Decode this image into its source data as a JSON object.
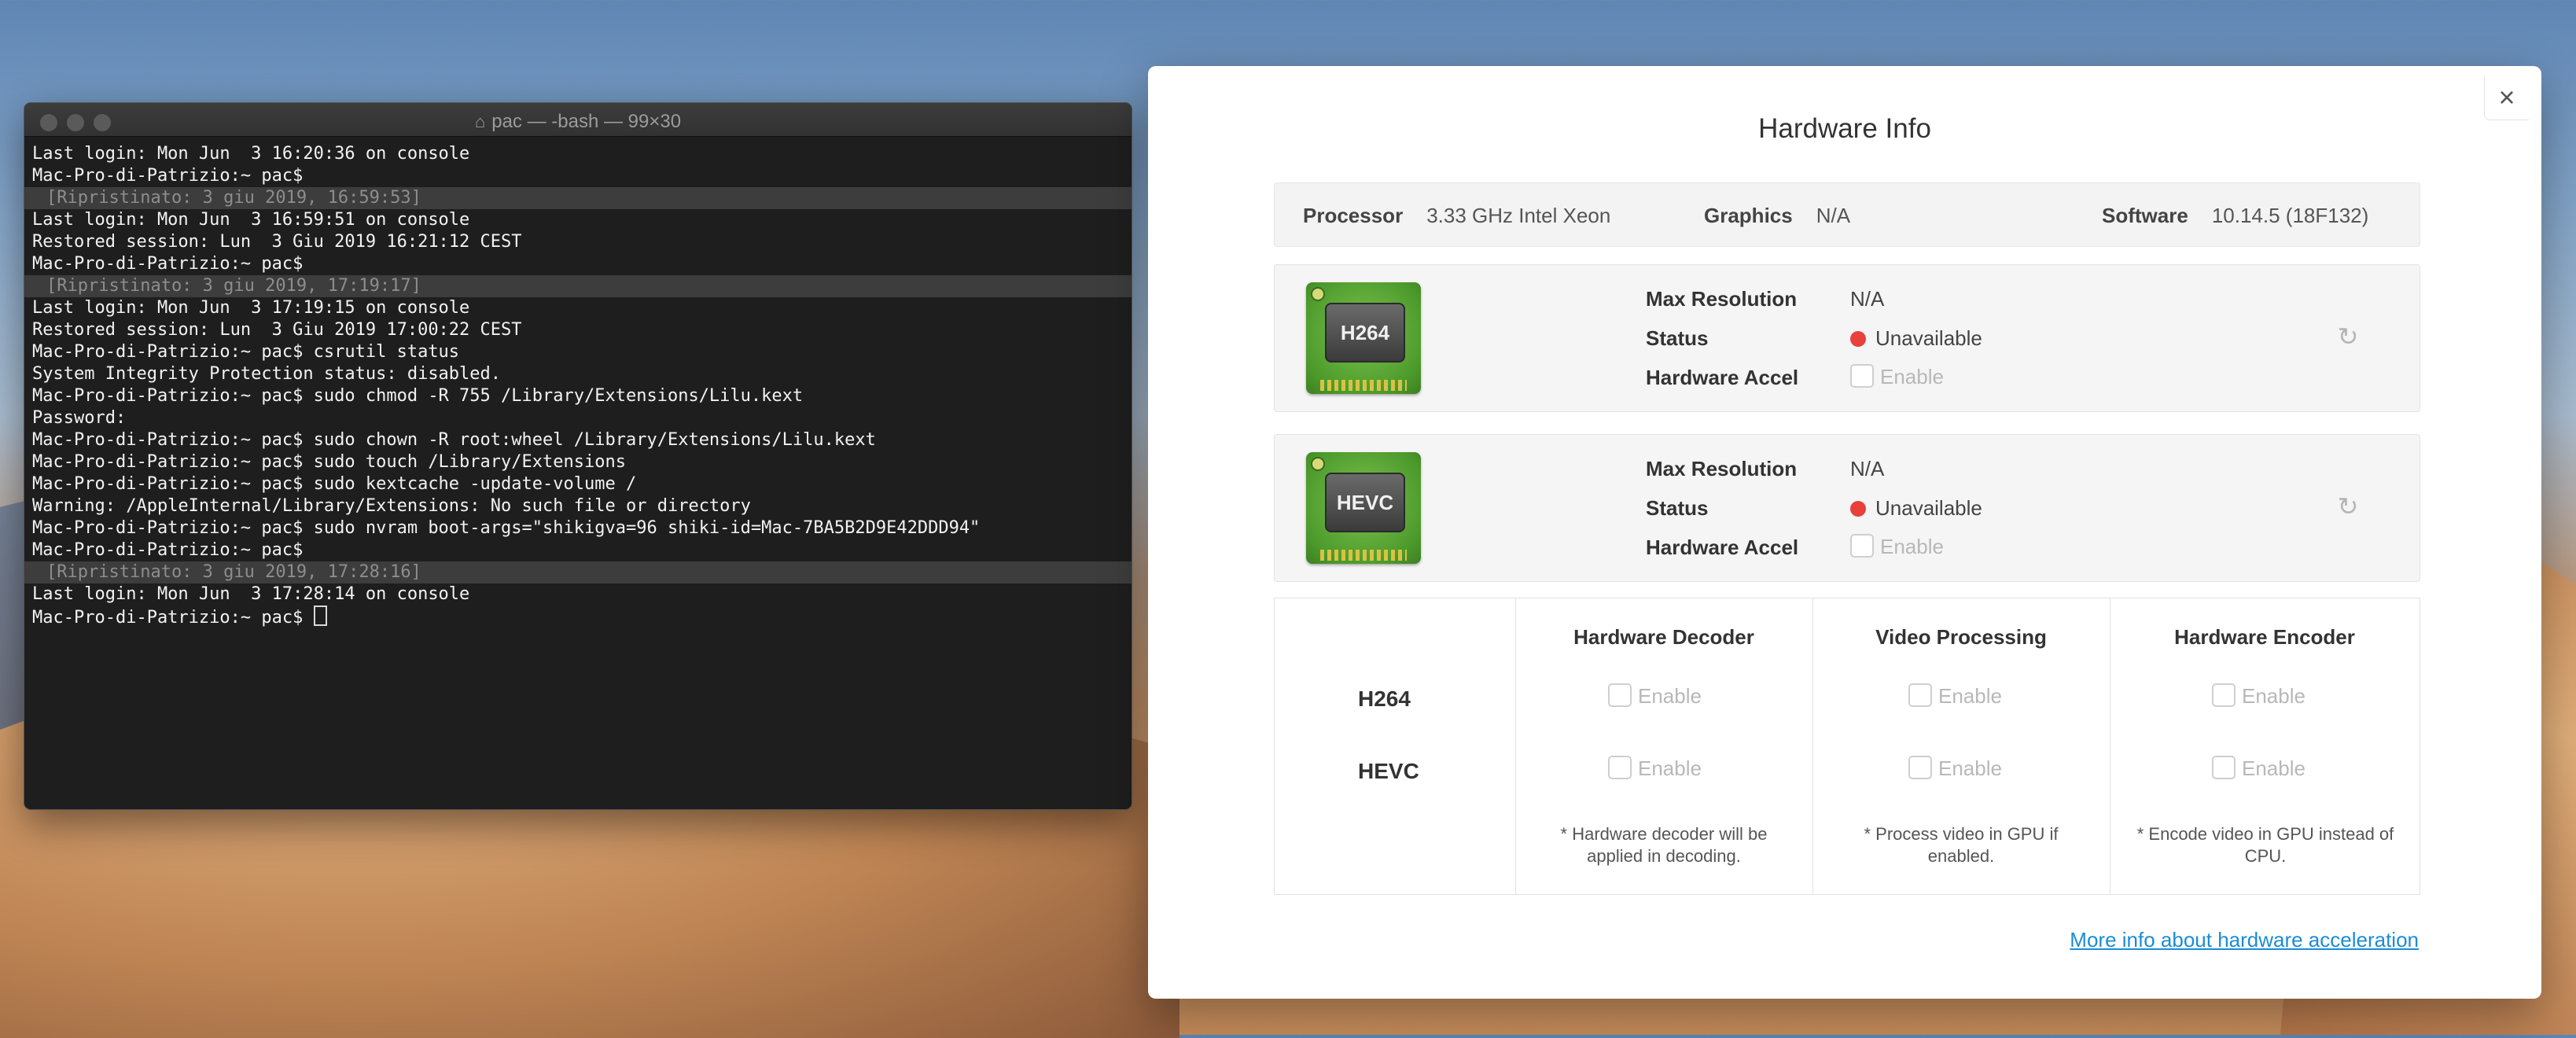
{
  "terminal": {
    "title": "pac — -bash — 99×30",
    "lines": [
      {
        "text": "Last login: Mon Jun  3 16:20:36 on console",
        "marked": false
      },
      {
        "text": "Mac-Pro-di-Patrizio:~ pac$",
        "marked": false
      },
      {
        "text": "[Ripristinato: 3 giu 2019, 16:59:53]",
        "marked": true
      },
      {
        "text": "Last login: Mon Jun  3 16:59:51 on console",
        "marked": false
      },
      {
        "text": "Restored session: Lun  3 Giu 2019 16:21:12 CEST",
        "marked": false
      },
      {
        "text": "Mac-Pro-di-Patrizio:~ pac$",
        "marked": false
      },
      {
        "text": "[Ripristinato: 3 giu 2019, 17:19:17]",
        "marked": true
      },
      {
        "text": "Last login: Mon Jun  3 17:19:15 on console",
        "marked": false
      },
      {
        "text": "Restored session: Lun  3 Giu 2019 17:00:22 CEST",
        "marked": false
      },
      {
        "text": "Mac-Pro-di-Patrizio:~ pac$ csrutil status",
        "marked": false
      },
      {
        "text": "System Integrity Protection status: disabled.",
        "marked": false
      },
      {
        "text": "Mac-Pro-di-Patrizio:~ pac$ sudo chmod -R 755 /Library/Extensions/Lilu.kext",
        "marked": false
      },
      {
        "text": "Password:",
        "marked": false
      },
      {
        "text": "Mac-Pro-di-Patrizio:~ pac$ sudo chown -R root:wheel /Library/Extensions/Lilu.kext",
        "marked": false
      },
      {
        "text": "Mac-Pro-di-Patrizio:~ pac$ sudo touch /Library/Extensions",
        "marked": false
      },
      {
        "text": "Mac-Pro-di-Patrizio:~ pac$ sudo kextcache -update-volume /",
        "marked": false
      },
      {
        "text": "Warning: /AppleInternal/Library/Extensions: No such file or directory",
        "marked": false
      },
      {
        "text": "Mac-Pro-di-Patrizio:~ pac$ sudo nvram boot-args=\"shikigva=96 shiki-id=Mac-7BA5B2D9E42DDD94\"",
        "marked": false
      },
      {
        "text": "Mac-Pro-di-Patrizio:~ pac$",
        "marked": false
      },
      {
        "text": "[Ripristinato: 3 giu 2019, 17:28:16]",
        "marked": true
      },
      {
        "text": "Last login: Mon Jun  3 17:28:14 on console",
        "marked": false
      },
      {
        "text": "Mac-Pro-di-Patrizio:~ pac$ ",
        "marked": false,
        "cursor": true
      }
    ]
  },
  "dialog": {
    "title": "Hardware Info",
    "close_icon": "×",
    "info": {
      "processor_label": "Processor",
      "processor_value": "3.33 GHz Intel Xeon",
      "graphics_label": "Graphics",
      "graphics_value": "N/A",
      "software_label": "Software",
      "software_value": "10.14.5 (18F132)"
    },
    "codecs": [
      {
        "chip_label": "H264",
        "max_res_label": "Max Resolution",
        "max_res_value": "N/A",
        "status_label": "Status",
        "status_value": "Unavailable",
        "accel_label": "Hardware Accel",
        "accel_option": "Enable"
      },
      {
        "chip_label": "HEVC",
        "max_res_label": "Max Resolution",
        "max_res_value": "N/A",
        "status_label": "Status",
        "status_value": "Unavailable",
        "accel_label": "Hardware Accel",
        "accel_option": "Enable"
      }
    ],
    "matrix": {
      "headers": [
        "Hardware Decoder",
        "Video Processing",
        "Hardware Encoder"
      ],
      "rows": [
        "H264",
        "HEVC"
      ],
      "option": "Enable",
      "notes": [
        "* Hardware decoder will be applied in decoding.",
        "* Process video in GPU if enabled.",
        "* Encode video in GPU instead of CPU."
      ]
    },
    "more_link": "More info about hardware acceleration",
    "status_color": "#e8403b",
    "link_color": "#1b8cd6"
  }
}
